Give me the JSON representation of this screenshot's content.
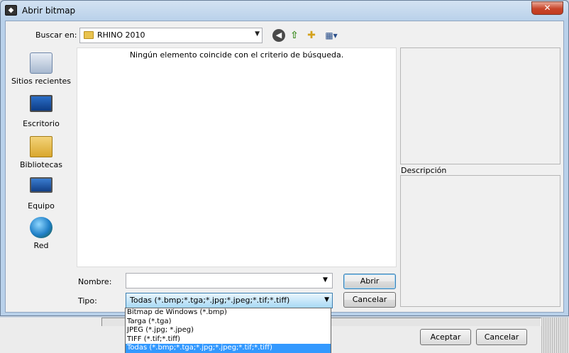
{
  "window": {
    "title": "Abrir bitmap",
    "close_glyph": "✕"
  },
  "toolbar": {
    "look_in_label": "Buscar en:",
    "look_in_value": "RHINO 2010",
    "back_icon": "back-arrow-icon",
    "up_icon": "up-folder-icon",
    "new_folder_icon": "new-folder-icon",
    "views_icon": "view-menu-icon"
  },
  "places": [
    {
      "label": "Sitios recientes",
      "icon": "recent-places-icon"
    },
    {
      "label": "Escritorio",
      "icon": "desktop-icon"
    },
    {
      "label": "Bibliotecas",
      "icon": "libraries-icon"
    },
    {
      "label": "Equipo",
      "icon": "computer-icon"
    },
    {
      "label": "Red",
      "icon": "network-icon"
    }
  ],
  "filelist": {
    "empty_message": "Ningún elemento coincide con el criterio de búsqueda."
  },
  "preview": {
    "description_label": "Descripción"
  },
  "form": {
    "name_label": "Nombre:",
    "name_value": "",
    "type_label": "Tipo:",
    "type_value": "Todas (*.bmp;*.tga;*.jpg;*.jpeg;*.tif;*.tiff)",
    "open_label": "Abrir",
    "cancel_label": "Cancelar"
  },
  "type_options": [
    "Bitmap de Windows (*.bmp)",
    "Targa (*.tga)",
    "JPEG (*.jpg; *.jpeg)",
    "TIFF (*.tif;*.tiff)",
    "Todas (*.bmp;*.tga;*.jpg;*.jpeg;*.tif;*.tiff)"
  ],
  "type_selected_index": 4,
  "background_dialog": {
    "accept_label": "Aceptar",
    "cancel_label": "Cancelar"
  }
}
